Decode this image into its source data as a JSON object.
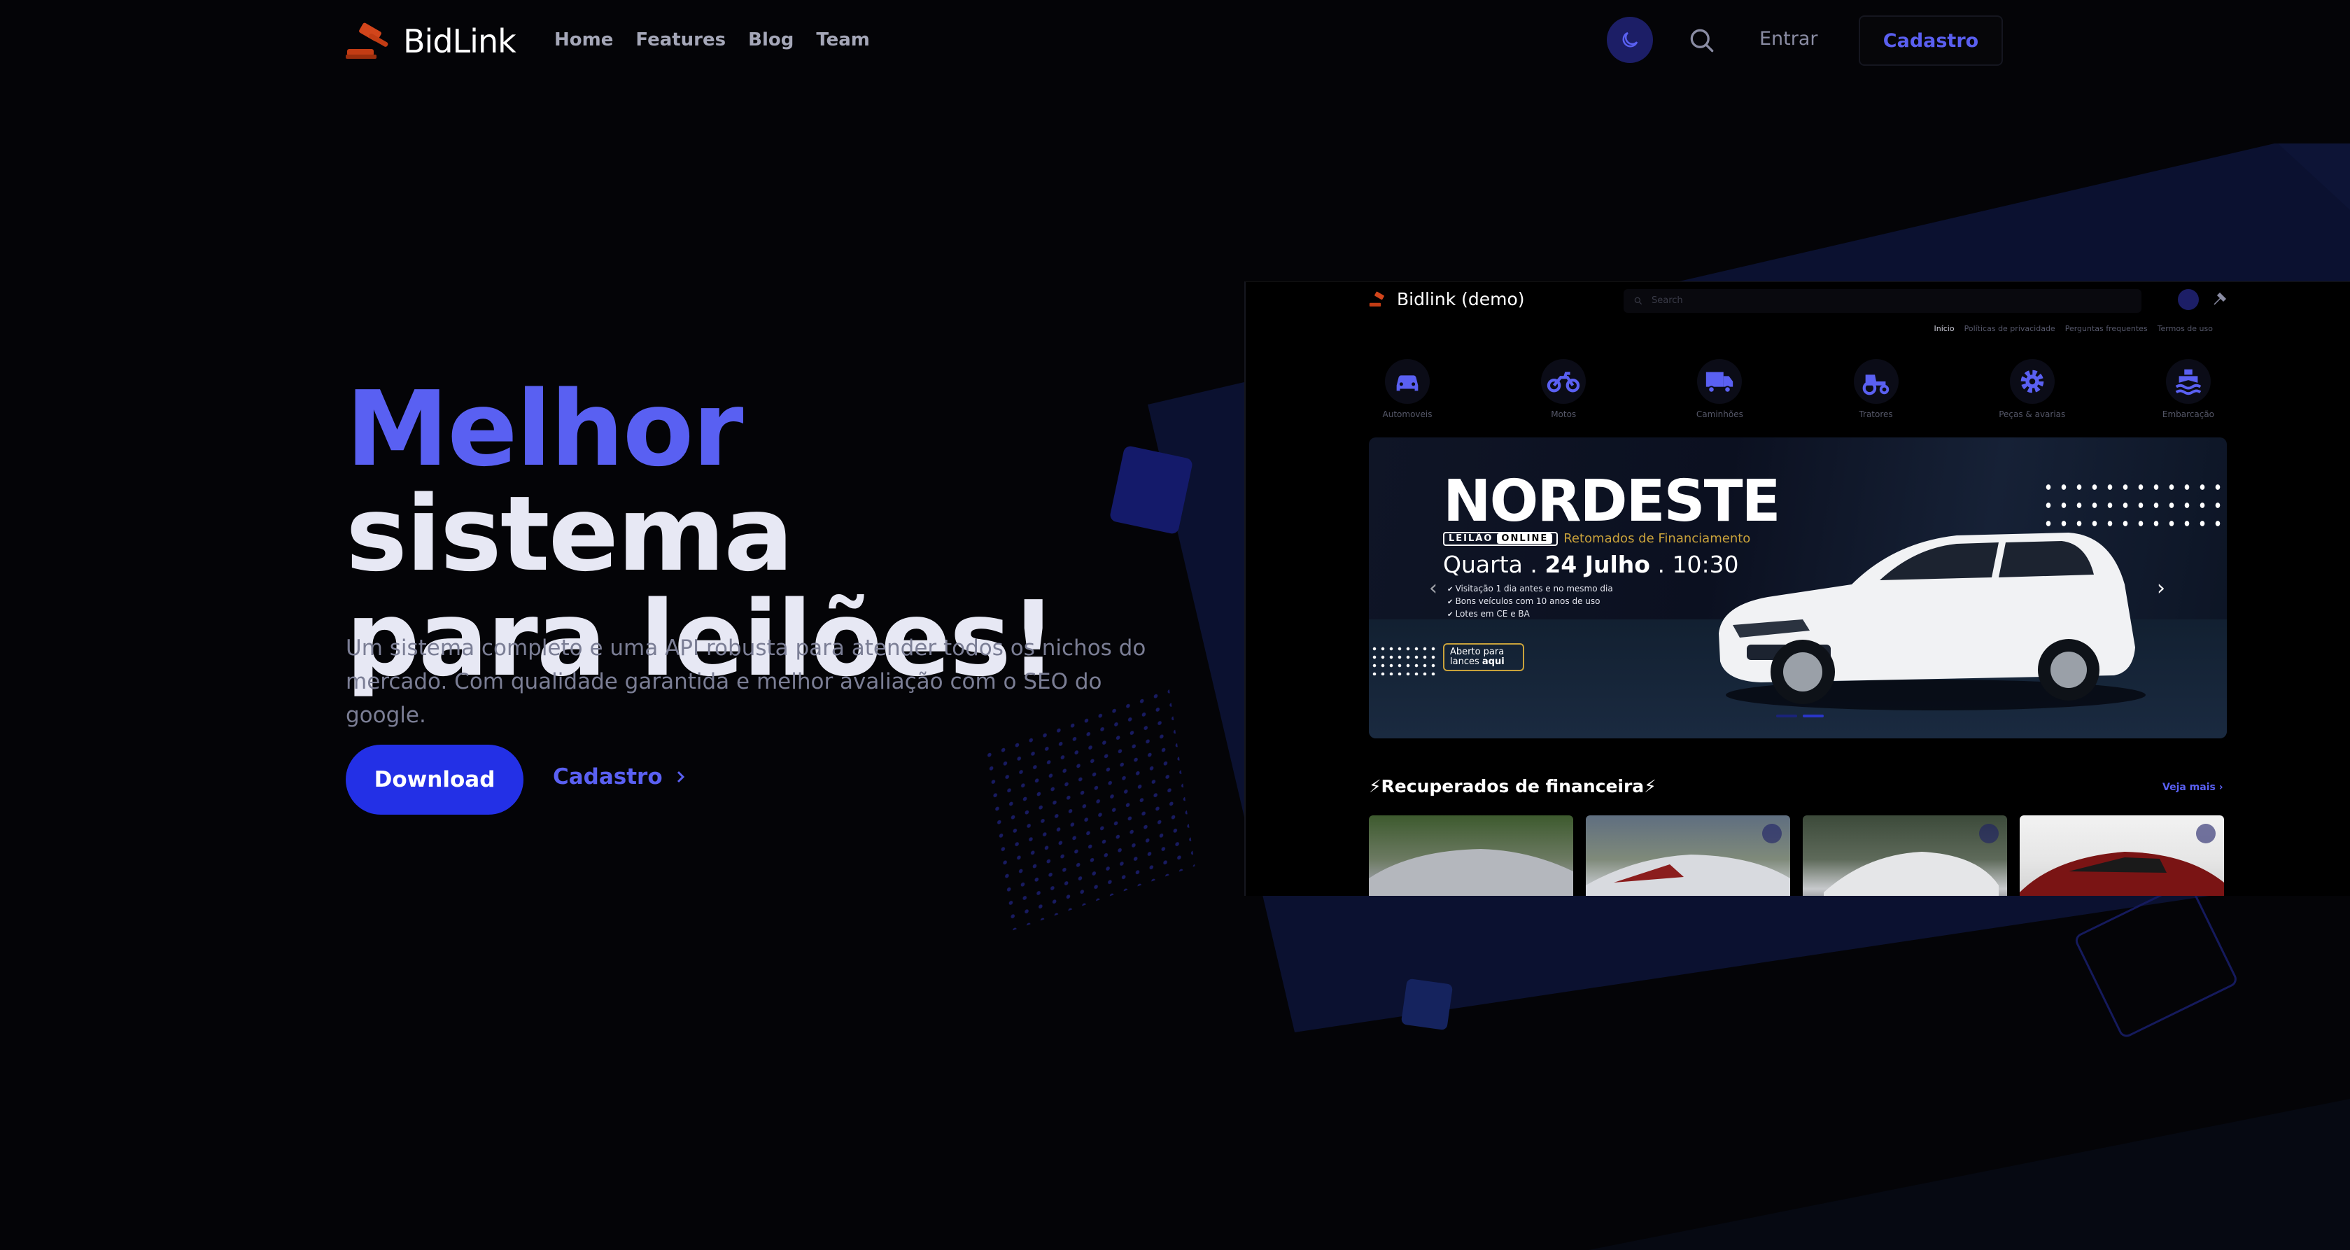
{
  "header": {
    "brand": "BidLink",
    "nav": [
      "Home",
      "Features",
      "Blog",
      "Team"
    ],
    "login_label": "Entrar",
    "signup_label": "Cadastro"
  },
  "hero": {
    "title_accent": "Melhor",
    "title_rest_1": " sistema",
    "title_rest_2": "para leilões!",
    "subtitle": "Um sistema completo e uma API robusta para atender todos os nichos do mercado. Com qualidade garantida e melhor avaliação com o SEO do google.",
    "download_label": "Download",
    "cadastro_label": "Cadastro"
  },
  "demo": {
    "brand": "Bidlink (demo)",
    "search_placeholder": "Search",
    "links": [
      "Início",
      "Políticas de privacidade",
      "Perguntas frequentes",
      "Termos de uso"
    ],
    "categories": [
      {
        "label": "Automoveis",
        "icon": "car-icon"
      },
      {
        "label": "Motos",
        "icon": "motorcycle-icon"
      },
      {
        "label": "Caminhões",
        "icon": "truck-icon"
      },
      {
        "label": "Tratores",
        "icon": "tractor-icon"
      },
      {
        "label": "Peças & avarias",
        "icon": "gear-icon"
      },
      {
        "label": "Embarcação",
        "icon": "ship-icon"
      }
    ],
    "banner": {
      "title": "NORDESTE",
      "tag_leilao": "LEILÃO",
      "tag_online": "ONLINE",
      "tag_sub": "Retomados de Financiamento",
      "date_day": "Quarta . ",
      "date_bold": "24 Julho",
      "date_time": " . 10:30",
      "checks": [
        "Visitação 1 dia antes e no mesmo dia",
        "Bons veículos com 10 anos de uso",
        "Lotes em CE e BA"
      ],
      "cta_1": "Aberto para",
      "cta_2_plain": "lances ",
      "cta_2_bold": "aqui"
    },
    "section_title": "⚡Recuperados de financeira⚡",
    "see_more": "Veja mais"
  },
  "colors": {
    "accent": "#5960f2",
    "primary_button": "#2330e6",
    "background": "#040407",
    "moon_bg": "#1c1e66"
  }
}
